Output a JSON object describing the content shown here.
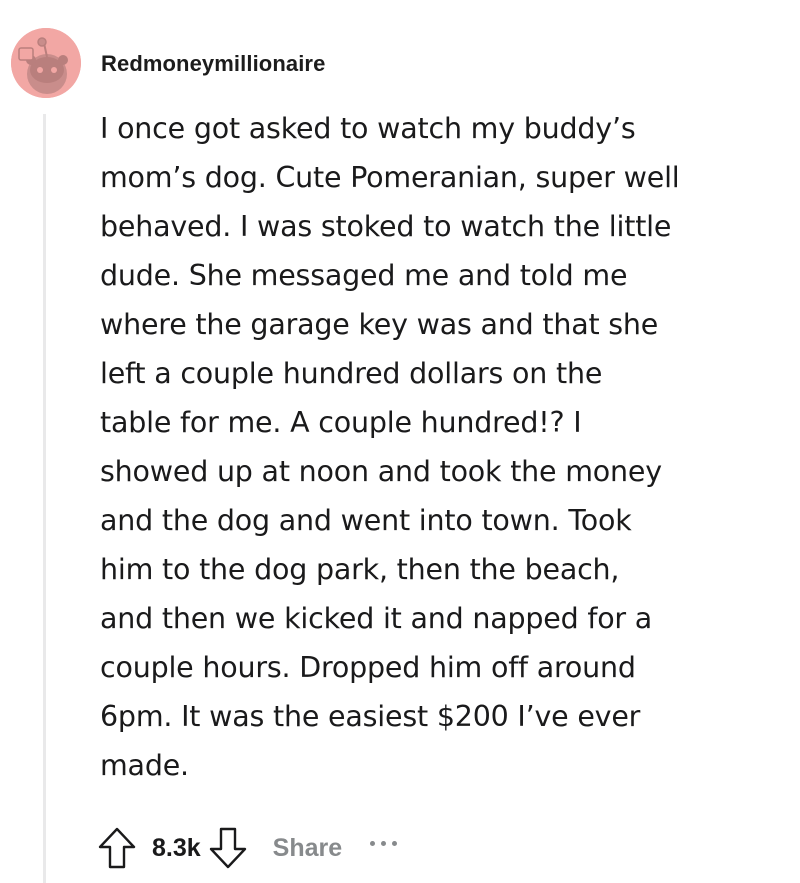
{
  "comment": {
    "username": "Redmoneymillionaire",
    "avatar_icon": "reddit-snoo-avatar-icon",
    "avatar_color": "#f2a7a4",
    "body_lines": [
      "I once got asked to watch my buddy’s",
      "mom’s dog. Cute Pomeranian, super well",
      "behaved. I was stoked to watch the little",
      "dude. She messaged me and told me",
      "where the garage key was and that she",
      "left a couple hundred dollars on the",
      "table for me. A couple hundred!? I",
      "showed up at noon and took the money",
      "and the dog and went into town. Took",
      "him to the dog park, then the beach,",
      "and then we kicked it and napped for a",
      "couple hours. Dropped him off around",
      "6pm. It was the easiest $200 I’ve ever",
      "made."
    ]
  },
  "actions": {
    "upvote_icon": "upvote-arrow-icon",
    "score": "8.3k",
    "downvote_icon": "downvote-arrow-icon",
    "share_label": "Share",
    "more_icon": "more-options-icon",
    "muted_color": "#878a8c"
  }
}
